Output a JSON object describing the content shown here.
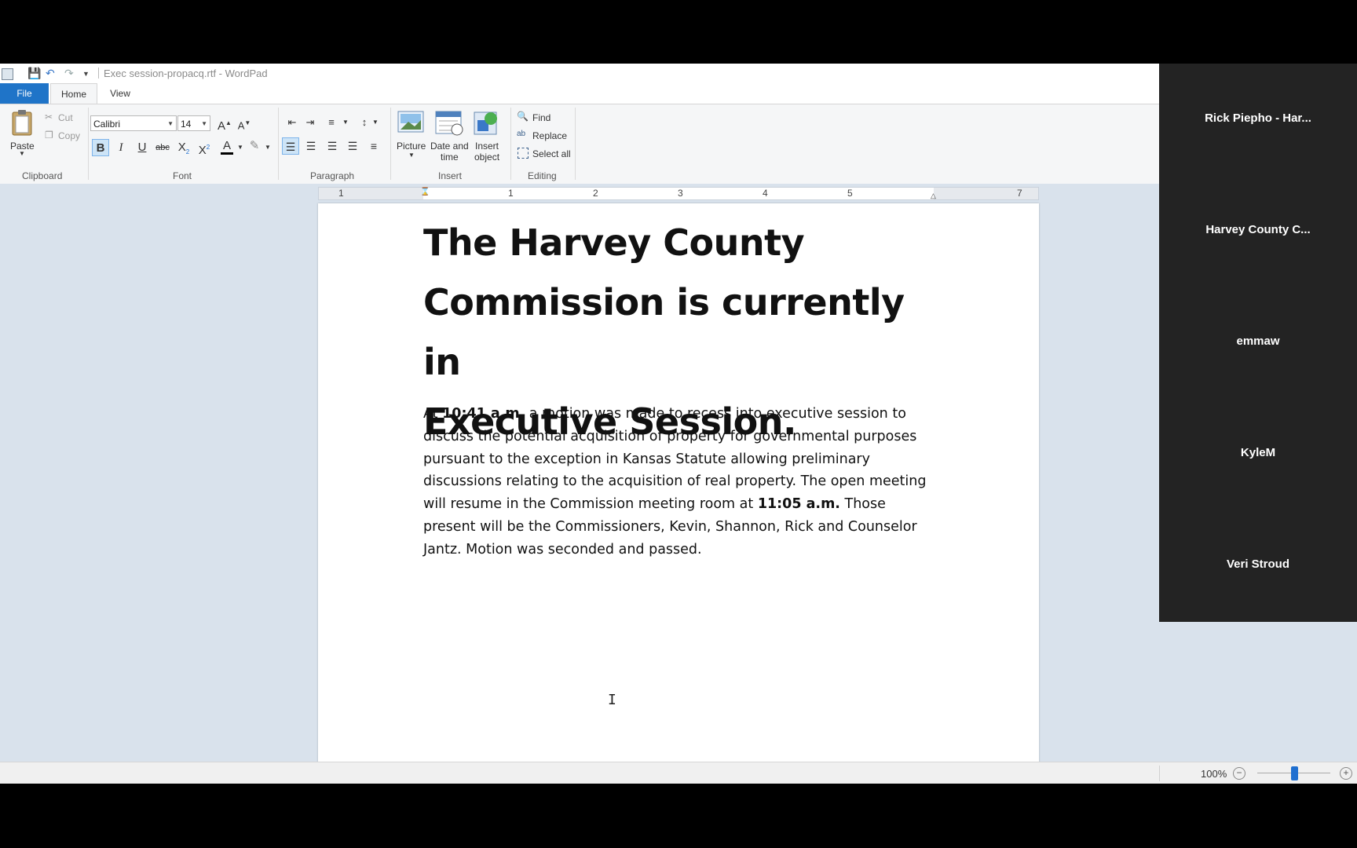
{
  "window": {
    "title": "Exec session-propacq.rtf - WordPad"
  },
  "ribbon_tabs": [
    "File",
    "Home",
    "View"
  ],
  "clipboard": {
    "paste": "Paste",
    "cut": "Cut",
    "copy": "Copy",
    "group": "Clipboard"
  },
  "font": {
    "family": "Calibri",
    "size": "14",
    "group": "Font"
  },
  "paragraph": {
    "group": "Paragraph"
  },
  "insert": {
    "picture": "Picture",
    "datetime_1": "Date and",
    "datetime_2": "time",
    "object_1": "Insert",
    "object_2": "object",
    "group": "Insert"
  },
  "editing": {
    "find": "Find",
    "replace": "Replace",
    "select_all": "Select all",
    "group": "Editing"
  },
  "ruler": {
    "numbers": [
      "1",
      "1",
      "2",
      "3",
      "4",
      "5",
      "7"
    ]
  },
  "document": {
    "heading_1": "The Harvey County",
    "heading_2": "Commission is currently in",
    "heading_3": "Executive Session.",
    "p_1": "At ",
    "time_1": "10:41 a.m.",
    "p_2": " a motion was made to recess into executive session to discuss the potential acquisition of property for governmental purposes pursuant to the exception in Kansas Statute allowing preliminary discussions relating to the acquisition of real property. The open meeting will resume in the Commission meeting room at ",
    "time_2": "11:05 a.m.",
    "p_3": " Those present will be the Commissioners, Kevin, Shannon, Rick and Counselor Jantz. Motion was seconded and passed."
  },
  "status": {
    "zoom": "100%",
    "zoom_level_fraction": 0.5
  },
  "participants": [
    "Rick Piepho - Har...",
    "Harvey County C...",
    "emmaw",
    "KyleM",
    "Veri Stroud"
  ],
  "colors": {
    "file_tab": "#1f74c8",
    "ribbon_bg": "#f5f6f7",
    "workspace_bg": "#d9e2ec",
    "call_panel_bg": "#232323"
  }
}
